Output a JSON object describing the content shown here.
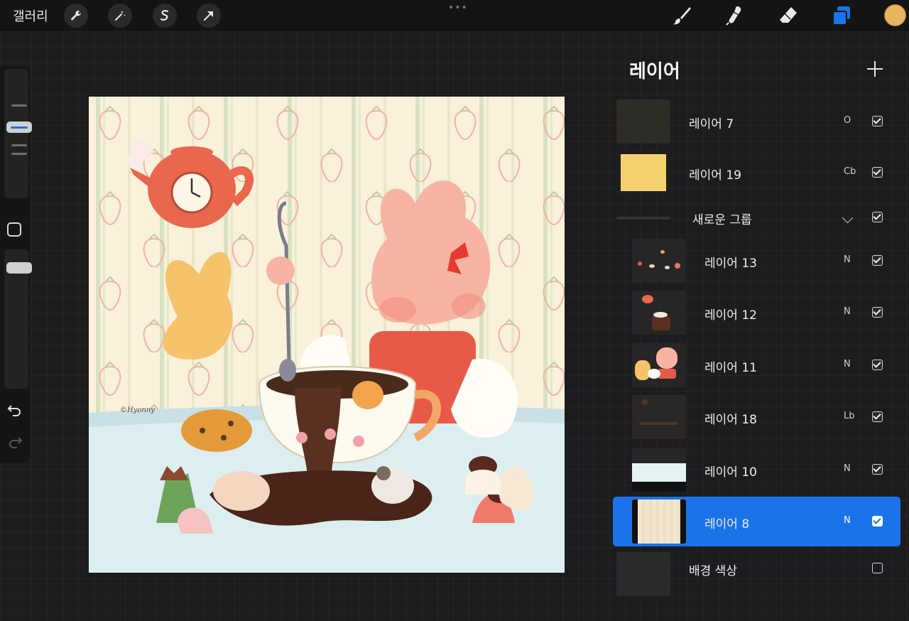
{
  "toolbar": {
    "gallery_label": "갤러리",
    "left_tools": [
      "wrench-icon",
      "magic-wand-icon",
      "selection-s-icon",
      "arrow-transform-icon"
    ],
    "right_tools": [
      "brush-icon",
      "smudge-icon",
      "eraser-icon",
      "layers-icon"
    ],
    "more_dots": "•••",
    "current_color": "#e9b45c",
    "accent": "#1a73e8"
  },
  "sidebar": {
    "tools": [
      "brush-size-slider",
      "modify-button",
      "opacity-slider",
      "undo-icon",
      "redo-icon"
    ]
  },
  "artwork": {
    "signature": "©Hyonny"
  },
  "layers_panel": {
    "title": "레이어",
    "add_icon": "plus-icon",
    "layers": [
      {
        "name": "레이어 7",
        "blend": "O",
        "visible": true
      },
      {
        "name": "레이어 19",
        "blend": "Cb",
        "visible": true
      },
      {
        "name": "새로운 그룹",
        "blend": "",
        "visible": true,
        "group": true
      },
      {
        "name": "레이어 13",
        "blend": "N",
        "visible": true
      },
      {
        "name": "레이어 12",
        "blend": "N",
        "visible": true
      },
      {
        "name": "레이어 11",
        "blend": "N",
        "visible": true
      },
      {
        "name": "레이어 18",
        "blend": "Lb",
        "visible": true
      },
      {
        "name": "레이어 10",
        "blend": "N",
        "visible": true
      },
      {
        "name": "레이어 8",
        "blend": "N",
        "visible": true,
        "active": true
      },
      {
        "name": "배경 색상",
        "blend": "",
        "visible": false
      }
    ]
  }
}
